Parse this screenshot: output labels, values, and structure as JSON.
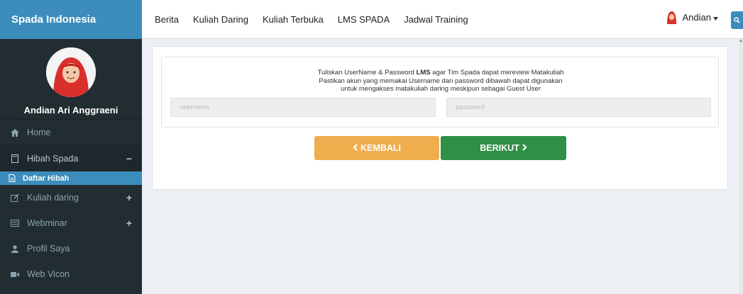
{
  "sidebar": {
    "brand": "Spada Indonesia",
    "user_name": "Andian Ari Anggraeni",
    "items": [
      {
        "label": "Home",
        "icon": "home-icon"
      },
      {
        "label": "Hibah Spada",
        "icon": "book-icon",
        "sign": "−"
      },
      {
        "label": "Daftar Hibah",
        "icon": "document-icon"
      },
      {
        "label": "Kuliah daring",
        "icon": "edit-icon",
        "sign": "+"
      },
      {
        "label": "Webminar",
        "icon": "list-icon",
        "sign": "+"
      },
      {
        "label": "Profil Saya",
        "icon": "user-icon"
      },
      {
        "label": "Web Vicon",
        "icon": "video-icon"
      }
    ]
  },
  "topbar": {
    "nav": [
      "Berita",
      "Kuliah Daring",
      "Kuliah Terbuka",
      "LMS SPADA",
      "Jadwal Training"
    ],
    "user_label": "Andian"
  },
  "form": {
    "line1_pre": "Tuliskan UserName & Password ",
    "line1_bold": "LMS",
    "line1_post": " agar Tim Spada dapat mereview Matakuliah",
    "line2": "Pastikan akun yang memakai Username dan password dibawah dapat digunakan",
    "line3": "untuk mengakses matakuliah daring meskipun sebagai Guest User",
    "username_placeholder": "username",
    "password_placeholder": "password",
    "back_label": "KEMBALI",
    "next_label": "BERIKUT"
  },
  "colors": {
    "brand": "#3c8dbc",
    "sidebar_bg": "#222d32",
    "back_button": "#f0ad4e",
    "next_button": "#2f8f45"
  }
}
